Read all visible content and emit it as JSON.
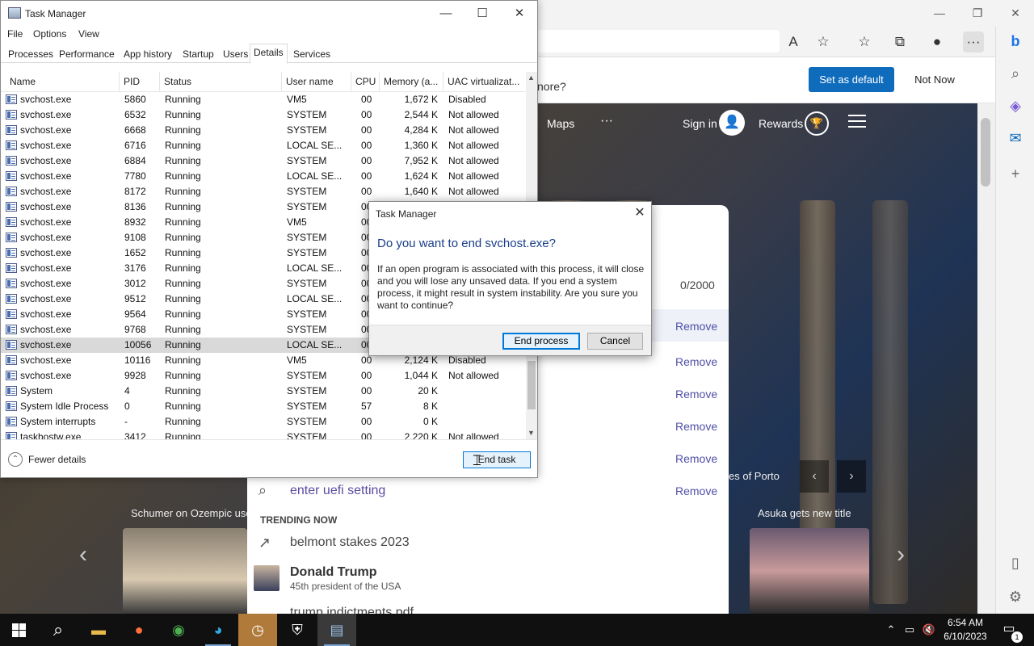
{
  "edge": {
    "window_controls": {
      "minimize": "—",
      "restore": "❐",
      "close": "✕"
    },
    "infobar": {
      "message": "nore?",
      "set_default": "Set as default",
      "not_now": "Not Now"
    },
    "nav": {
      "maps": "Maps",
      "more": "···",
      "sign_in": "Sign in",
      "rewards": "Rewards"
    },
    "suggest": {
      "char_count": "0/2000",
      "remove_label": "Remove",
      "query": "enter uefi setting",
      "trending_heading": "TRENDING NOW",
      "trending": [
        {
          "title": "belmont stakes 2023"
        },
        {
          "title": "Donald Trump",
          "subtitle": "45th president of the USA"
        },
        {
          "title": "trump indictments pdf"
        }
      ]
    },
    "news": {
      "left_caption": "Schumer on Ozempic use",
      "right_caption": "Asuka gets new title",
      "mid_caption": "es of Porto"
    }
  },
  "taskmgr": {
    "title": "Task Manager",
    "window_controls": {
      "minimize": "—",
      "maximize": "☐",
      "close": "✕"
    },
    "menu": [
      "File",
      "Options",
      "View"
    ],
    "tabs": [
      "Processes",
      "Performance",
      "App history",
      "Startup",
      "Users",
      "Details",
      "Services"
    ],
    "active_tab": "Details",
    "columns": [
      "Name",
      "PID",
      "Status",
      "User name",
      "CPU",
      "Memory (a...",
      "UAC virtualizat..."
    ],
    "rows": [
      [
        "svchost.exe",
        "5860",
        "Running",
        "VM5",
        "00",
        "1,672 K",
        "Disabled"
      ],
      [
        "svchost.exe",
        "6532",
        "Running",
        "SYSTEM",
        "00",
        "2,544 K",
        "Not allowed"
      ],
      [
        "svchost.exe",
        "6668",
        "Running",
        "SYSTEM",
        "00",
        "4,284 K",
        "Not allowed"
      ],
      [
        "svchost.exe",
        "6716",
        "Running",
        "LOCAL SE...",
        "00",
        "1,360 K",
        "Not allowed"
      ],
      [
        "svchost.exe",
        "6884",
        "Running",
        "SYSTEM",
        "00",
        "7,952 K",
        "Not allowed"
      ],
      [
        "svchost.exe",
        "7780",
        "Running",
        "LOCAL SE...",
        "00",
        "1,624 K",
        "Not allowed"
      ],
      [
        "svchost.exe",
        "8172",
        "Running",
        "SYSTEM",
        "00",
        "1,640 K",
        "Not allowed"
      ],
      [
        "svchost.exe",
        "8136",
        "Running",
        "SYSTEM",
        "00",
        "",
        ""
      ],
      [
        "svchost.exe",
        "8932",
        "Running",
        "VM5",
        "00",
        "",
        ""
      ],
      [
        "svchost.exe",
        "9108",
        "Running",
        "SYSTEM",
        "00",
        "",
        ""
      ],
      [
        "svchost.exe",
        "1652",
        "Running",
        "SYSTEM",
        "00",
        "",
        ""
      ],
      [
        "svchost.exe",
        "3176",
        "Running",
        "LOCAL SE...",
        "00",
        "",
        ""
      ],
      [
        "svchost.exe",
        "3012",
        "Running",
        "SYSTEM",
        "00",
        "",
        ""
      ],
      [
        "svchost.exe",
        "9512",
        "Running",
        "LOCAL SE...",
        "00",
        "",
        ""
      ],
      [
        "svchost.exe",
        "9564",
        "Running",
        "SYSTEM",
        "00",
        "",
        ""
      ],
      [
        "svchost.exe",
        "9768",
        "Running",
        "SYSTEM",
        "00",
        "",
        ""
      ],
      [
        "svchost.exe",
        "10056",
        "Running",
        "LOCAL SE...",
        "00",
        "",
        ""
      ],
      [
        "svchost.exe",
        "10116",
        "Running",
        "VM5",
        "00",
        "2,124 K",
        "Disabled"
      ],
      [
        "svchost.exe",
        "9928",
        "Running",
        "SYSTEM",
        "00",
        "1,044 K",
        "Not allowed"
      ],
      [
        "System",
        "4",
        "Running",
        "SYSTEM",
        "00",
        "20 K",
        ""
      ],
      [
        "System Idle Process",
        "0",
        "Running",
        "SYSTEM",
        "57",
        "8 K",
        ""
      ],
      [
        "System interrupts",
        "-",
        "Running",
        "SYSTEM",
        "00",
        "0 K",
        ""
      ],
      [
        "taskhostw.exe",
        "3412",
        "Running",
        "SYSTEM",
        "00",
        "2,220 K",
        "Not allowed"
      ]
    ],
    "selected_row": 16,
    "footer": {
      "fewer_details": "Fewer details",
      "end_task": "End task"
    }
  },
  "dialog": {
    "title": "Task Manager",
    "close": "✕",
    "heading": "Do you want to end svchost.exe?",
    "body": "If an open program is associated with this process, it will close and you will lose any unsaved data. If you end a system process, it might result in system instability. Are you sure you want to continue?",
    "end_process": "End process",
    "cancel": "Cancel"
  },
  "taskbar": {
    "time": "6:54 AM",
    "date": "6/10/2023",
    "notification_count": "1"
  }
}
